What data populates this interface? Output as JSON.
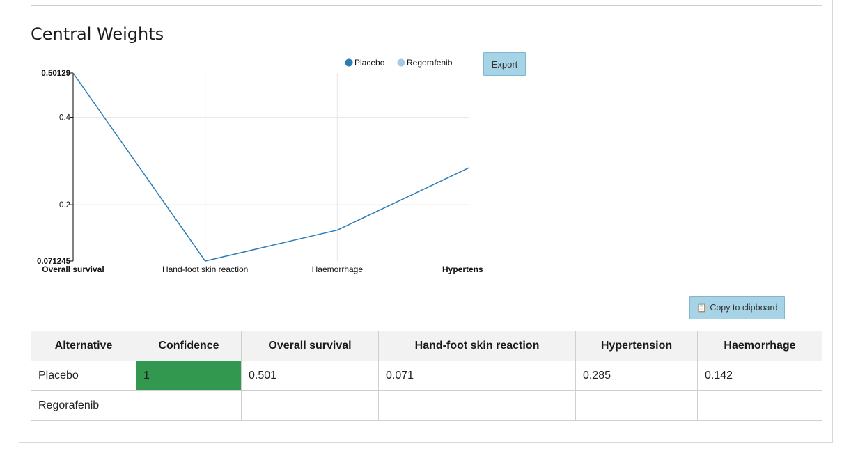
{
  "section": {
    "title": "Central Weights"
  },
  "buttons": {
    "export_label": "Export",
    "copy_label": "Copy to clipboard",
    "copy_icon": "clipboard-icon"
  },
  "colors": {
    "placebo": "#2b7bb4",
    "regorafenib": "#a6c9e6",
    "confidence_high": "#33984f",
    "button_bg": "#a6d4e6"
  },
  "chart_data": {
    "type": "line",
    "categories": [
      "Overall survival",
      "Hand-foot skin reaction",
      "Haemorrhage",
      "Hypertens"
    ],
    "series": [
      {
        "name": "Placebo",
        "values": [
          0.50129,
          0.071245,
          0.142,
          0.285
        ]
      }
    ],
    "legend": [
      "Placebo",
      "Regorafenib"
    ],
    "legend_position": "top-right",
    "ylim": [
      0.071245,
      0.50129
    ],
    "yticks": [
      "0.50129",
      "0.4",
      "0.2",
      "0.071245"
    ],
    "grid": true,
    "xlabel": "",
    "ylabel": "",
    "title": ""
  },
  "table": {
    "headers": [
      "Alternative",
      "Confidence",
      "Overall survival",
      "Hand-foot skin reaction",
      "Hypertension",
      "Haemorrhage"
    ],
    "rows": [
      [
        "Placebo",
        "1",
        "0.501",
        "0.071",
        "0.285",
        "0.142"
      ],
      [
        "Regorafenib",
        "",
        "",
        "",
        "",
        ""
      ]
    ]
  }
}
